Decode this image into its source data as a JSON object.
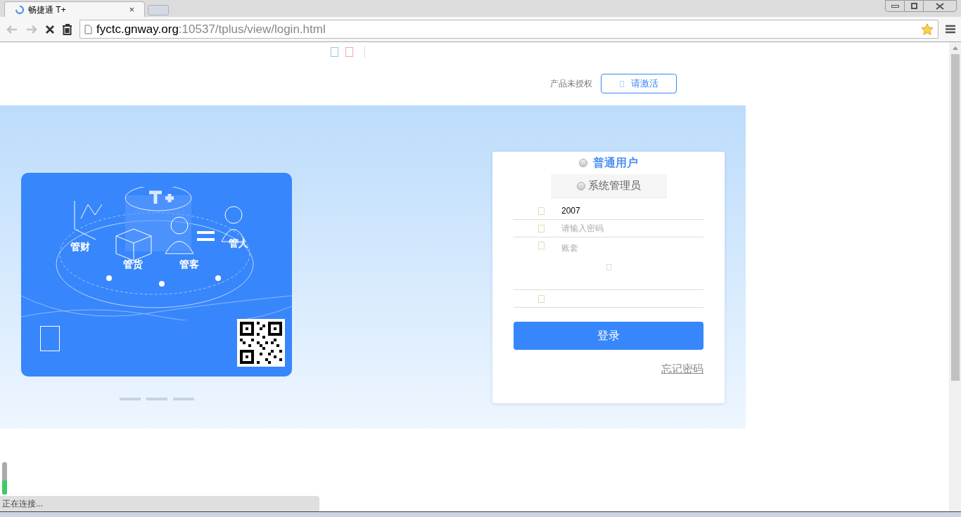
{
  "browser": {
    "tab_title": "畅捷通 T+",
    "tab_close": "×",
    "url_host": "fyctc.gnway.org",
    "url_path": ":10537/tplus/view/login.html"
  },
  "header": {
    "license_text": "产品未授权",
    "activate_button": "请激活"
  },
  "banner": {
    "labels": [
      "管财",
      "管货",
      "管客",
      "管人"
    ],
    "slides": [
      {
        "selected": false
      },
      {
        "selected": false
      },
      {
        "selected": false
      }
    ]
  },
  "login": {
    "roles": [
      {
        "label": "普通用户",
        "selected": true
      },
      {
        "label": "系统管理员",
        "selected": false
      }
    ],
    "fields": [
      {
        "value": "2007"
      },
      {
        "placeholder": "请输入密码"
      },
      {
        "placeholder": "账套"
      }
    ],
    "extra_row": true,
    "login_button": "登录",
    "forgot_link": "忘记密码"
  },
  "status_bar": "正在连接..."
}
